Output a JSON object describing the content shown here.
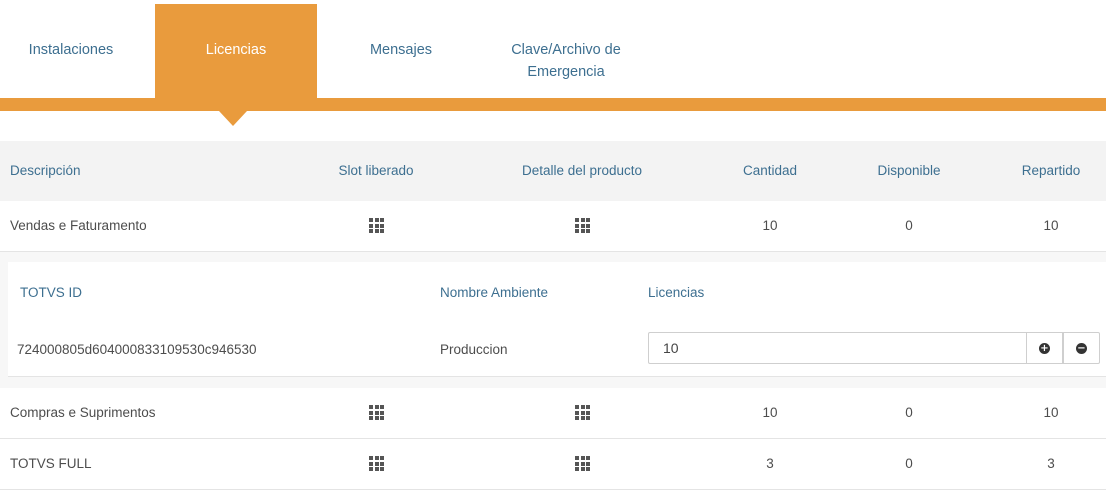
{
  "tabs": [
    {
      "label": "Instalaciones"
    },
    {
      "label": "Licencias"
    },
    {
      "label": "Mensajes"
    },
    {
      "label_line1": "Clave/Archivo de",
      "label_line2": "Emergencia"
    }
  ],
  "colors": {
    "accent": "#e99b3d",
    "header_text": "#3d6f90"
  },
  "table": {
    "headers": {
      "description": "Descripción",
      "slot": "Slot liberado",
      "detail": "Detalle del producto",
      "quantity": "Cantidad",
      "available": "Disponible",
      "distributed": "Repartido"
    },
    "rows": [
      {
        "description": "Vendas e Faturamento",
        "quantity": "10",
        "available": "0",
        "distributed": "10"
      },
      {
        "description": "Compras e Suprimentos",
        "quantity": "10",
        "available": "0",
        "distributed": "10"
      },
      {
        "description": "TOTVS FULL",
        "quantity": "3",
        "available": "0",
        "distributed": "3"
      }
    ],
    "slot_icon": "grid-icon",
    "detail_icon": "grid-icon"
  },
  "subpanel": {
    "headers": {
      "totvs_id": "TOTVS ID",
      "environment": "Nombre Ambiente",
      "licenses": "Licencias"
    },
    "row": {
      "totvs_id": "724000805d604000833109530c946530",
      "environment": "Produccion",
      "licenses_value": "10"
    },
    "plus_icon": "plus-circle-icon",
    "minus_icon": "minus-circle-icon"
  }
}
